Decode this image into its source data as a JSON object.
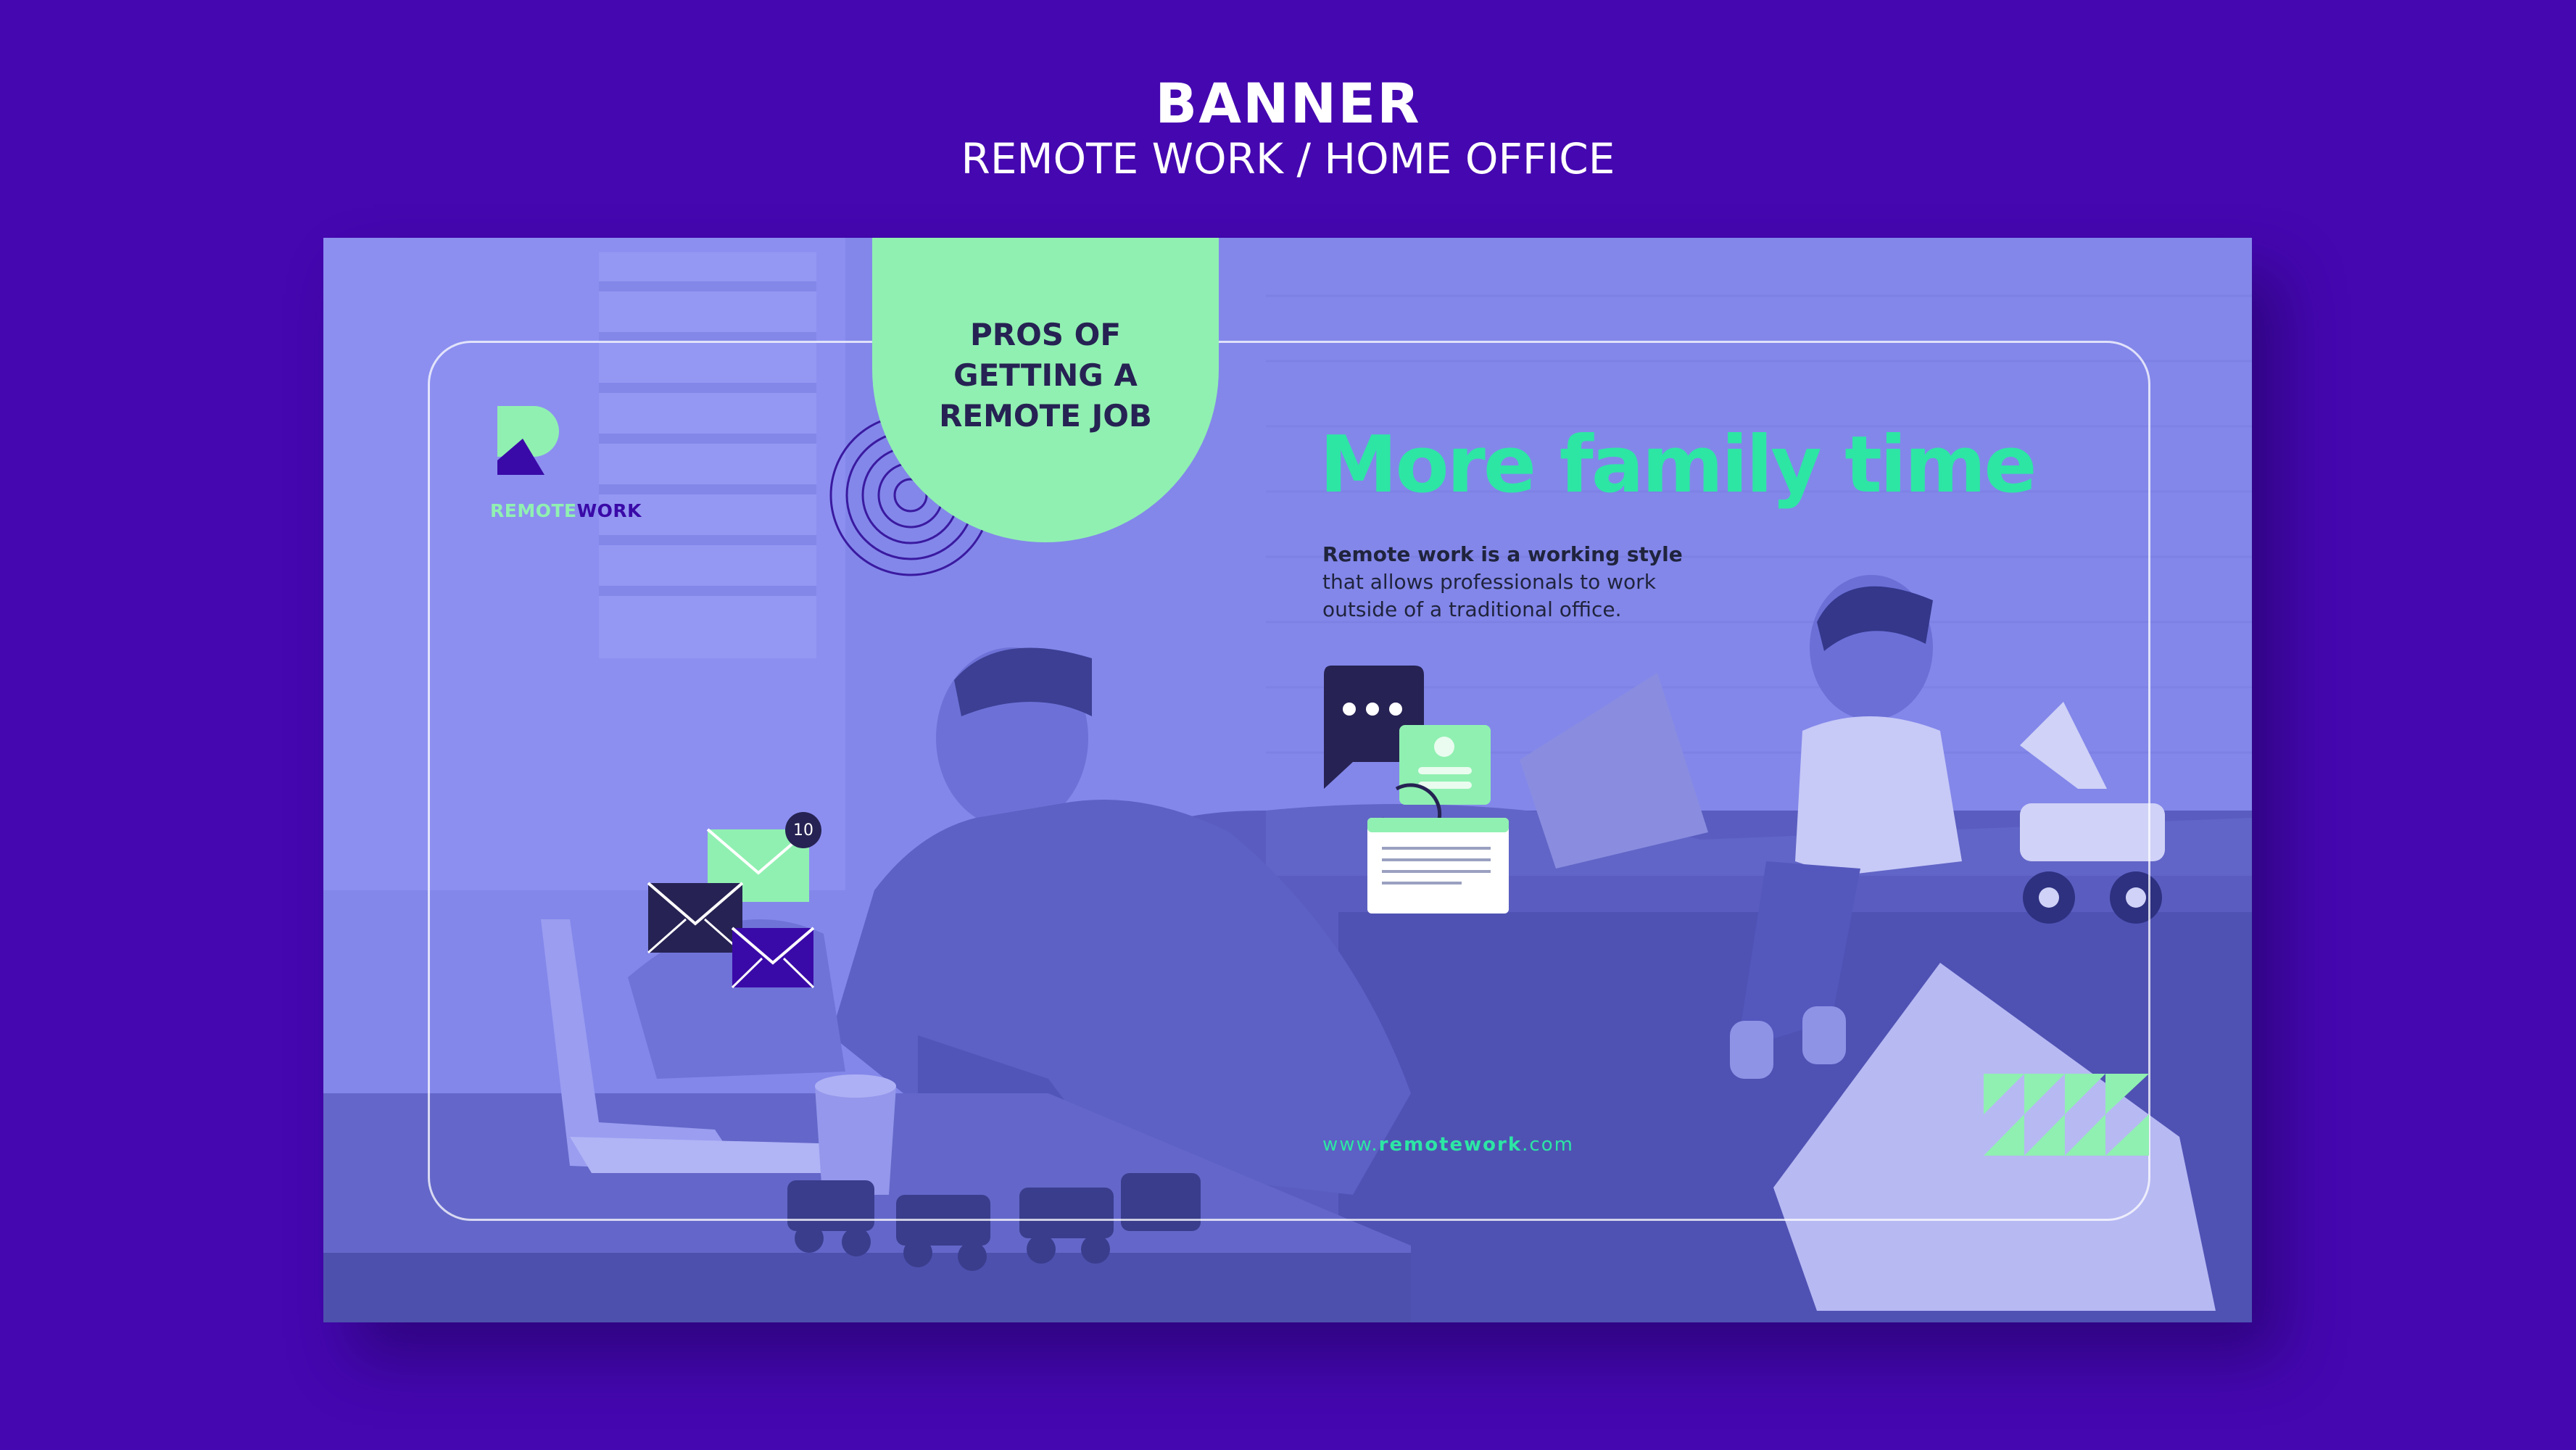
{
  "header": {
    "title": "BANNER",
    "subtitle": "REMOTE WORK / HOME OFFICE"
  },
  "banner": {
    "tab_text": "PROS OF GETTING A REMOTE JOB",
    "logo": {
      "word_part1": "REMOTE",
      "word_part2": "WORK"
    },
    "headline": "More family time",
    "description": {
      "lead": "Remote work is a working style",
      "rest": "that allows professionals to work outside of a traditional office."
    },
    "url": {
      "prefix": "www.",
      "domain": "remotework",
      "suffix": ".com"
    },
    "mail_badge_count": "10",
    "colors": {
      "background": "#4507b0",
      "banner_tint": "#7d80e6",
      "mint": "#90f0b1",
      "headline_green": "#2de6a4",
      "dark_navy": "#262253"
    },
    "icons": [
      "mail-icon",
      "chat-bubble-icon",
      "profile-card-icon",
      "document-window-icon",
      "concentric-circles-decoration",
      "triangle-pattern-decoration",
      "logo-r-icon"
    ]
  }
}
